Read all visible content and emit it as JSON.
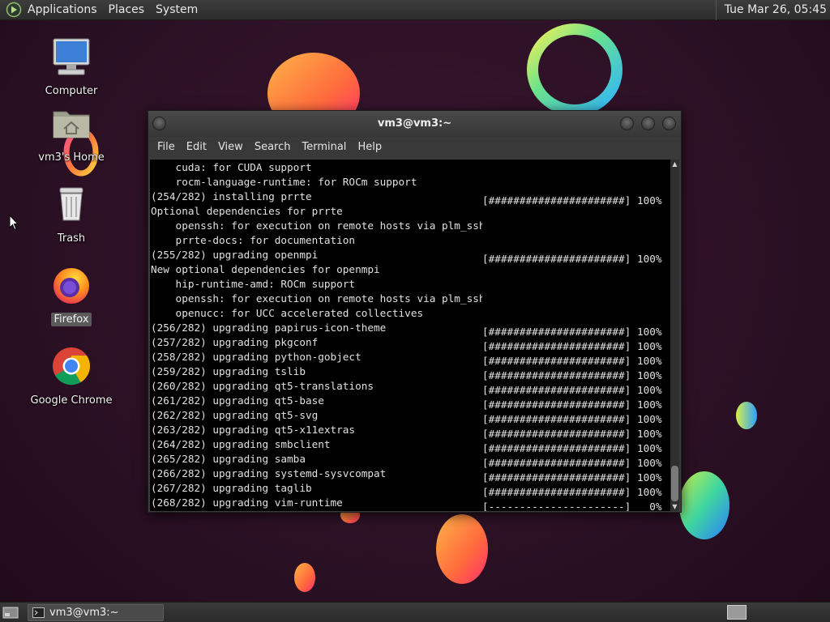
{
  "top_panel": {
    "menus": [
      "Applications",
      "Places",
      "System"
    ],
    "clock": "Tue Mar 26, 05:45"
  },
  "desktop_icons": [
    {
      "label": "Computer",
      "icon": "computer-icon"
    },
    {
      "label": "vm3's Home",
      "icon": "home-folder-icon"
    },
    {
      "label": "Trash",
      "icon": "trash-icon"
    },
    {
      "label": "Firefox",
      "icon": "firefox-icon",
      "selected": true
    },
    {
      "label": "Google Chrome",
      "icon": "chrome-icon"
    }
  ],
  "terminal": {
    "title": "vm3@vm3:~",
    "menus": [
      "File",
      "Edit",
      "View",
      "Search",
      "Terminal",
      "Help"
    ],
    "lines": [
      {
        "text": "    cuda: for CUDA support"
      },
      {
        "text": "    rocm-language-runtime: for ROCm support"
      },
      {
        "text": "(254/282) installing prrte",
        "bar": "[######################] 100%"
      },
      {
        "text": "Optional dependencies for prrte"
      },
      {
        "text": "    openssh: for execution on remote hosts via plm_ssh_agent [installed]"
      },
      {
        "text": "    prrte-docs: for documentation"
      },
      {
        "text": "(255/282) upgrading openmpi",
        "bar": "[######################] 100%"
      },
      {
        "text": "New optional dependencies for openmpi"
      },
      {
        "text": "    hip-runtime-amd: ROCm support"
      },
      {
        "text": "    openssh: for execution on remote hosts via plm_ssh_agent [installed]"
      },
      {
        "text": "    openucc: for UCC accelerated collectives"
      },
      {
        "text": "(256/282) upgrading papirus-icon-theme",
        "bar": "[######################] 100%"
      },
      {
        "text": "(257/282) upgrading pkgconf",
        "bar": "[######################] 100%"
      },
      {
        "text": "(258/282) upgrading python-gobject",
        "bar": "[######################] 100%"
      },
      {
        "text": "(259/282) upgrading tslib",
        "bar": "[######################] 100%"
      },
      {
        "text": "(260/282) upgrading qt5-translations",
        "bar": "[######################] 100%"
      },
      {
        "text": "(261/282) upgrading qt5-base",
        "bar": "[######################] 100%"
      },
      {
        "text": "(262/282) upgrading qt5-svg",
        "bar": "[######################] 100%"
      },
      {
        "text": "(263/282) upgrading qt5-x11extras",
        "bar": "[######################] 100%"
      },
      {
        "text": "(264/282) upgrading smbclient",
        "bar": "[######################] 100%"
      },
      {
        "text": "(265/282) upgrading samba",
        "bar": "[######################] 100%"
      },
      {
        "text": "(266/282) upgrading systemd-sysvcompat",
        "bar": "[######################] 100%"
      },
      {
        "text": "(267/282) upgrading taglib",
        "bar": "[######################] 100%"
      },
      {
        "text": "(268/282) upgrading vim-runtime",
        "bar": "[----------------------]   0%"
      }
    ]
  },
  "taskbar": {
    "task_label": "vm3@vm3:~"
  }
}
